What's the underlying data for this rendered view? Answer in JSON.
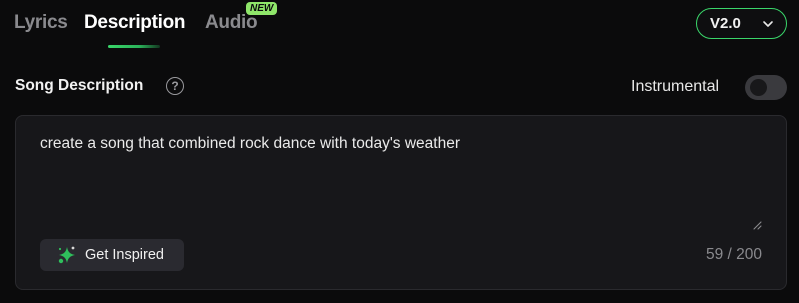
{
  "tabs": {
    "lyrics": "Lyrics",
    "description": "Description",
    "audio": "Audio",
    "audio_badge": "NEW",
    "active": "Description"
  },
  "version": {
    "selected": "V2.0"
  },
  "song_description": {
    "title": "Song Description",
    "help_glyph": "?",
    "instrumental_label": "Instrumental",
    "instrumental_on": false,
    "value": "create a song that combined rock dance with today's weather",
    "get_inspired_label": "Get Inspired",
    "char_count": "59 / 200"
  },
  "colors": {
    "accent": "#3ad66a",
    "badge": "#8fe66a",
    "background": "#0b0b0c",
    "panel": "#17171a"
  }
}
